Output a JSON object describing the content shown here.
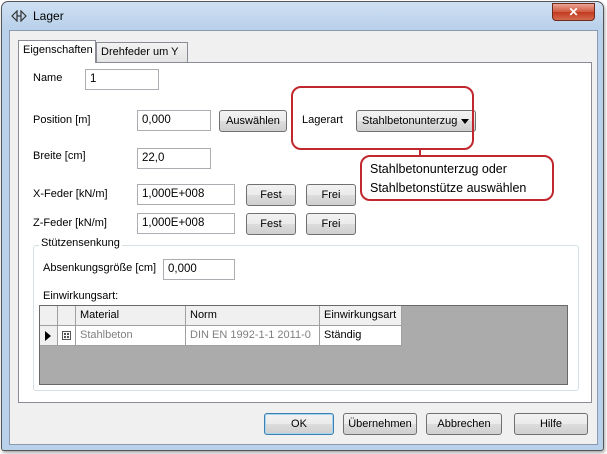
{
  "window": {
    "title": "Lager",
    "close_label": "✕"
  },
  "tabs": [
    {
      "label": "Eigenschaften"
    },
    {
      "label": "Drehfeder um Y"
    }
  ],
  "fields": {
    "name": {
      "label": "Name",
      "value": "1"
    },
    "position": {
      "label": "Position [m]",
      "value": "0,000",
      "button": "Auswählen"
    },
    "lagerart": {
      "label": "Lagerart",
      "value": "Stahlbetonunterzug"
    },
    "breite": {
      "label": "Breite [cm]",
      "value": "22,0"
    },
    "x_feder": {
      "label": "X-Feder [kN/m]",
      "value": "1,000E+008",
      "fest": "Fest",
      "frei": "Frei"
    },
    "z_feder": {
      "label": "Z-Feder [kN/m]",
      "value": "1,000E+008",
      "fest": "Fest",
      "frei": "Frei"
    }
  },
  "stuetzensenkung": {
    "title": "Stützensenkung",
    "absenkung_label": "Absenkungsgröße [cm]",
    "absenkung_value": "0,000",
    "einwirkungsart_label": "Einwirkungsart:"
  },
  "table": {
    "columns": [
      "Material",
      "Norm",
      "Einwirkungsart"
    ],
    "rows": [
      {
        "material": "Stahlbeton",
        "norm": "DIN EN 1992-1-1 2011-0",
        "einwirkungsart": "Ständig"
      }
    ]
  },
  "annotation": {
    "line1": "Stahlbetonunterzug oder",
    "line2": "Stahlbetonstütze auswählen"
  },
  "footer": {
    "ok": "OK",
    "apply": "Übernehmen",
    "cancel": "Abbrechen",
    "help": "Hilfe"
  }
}
